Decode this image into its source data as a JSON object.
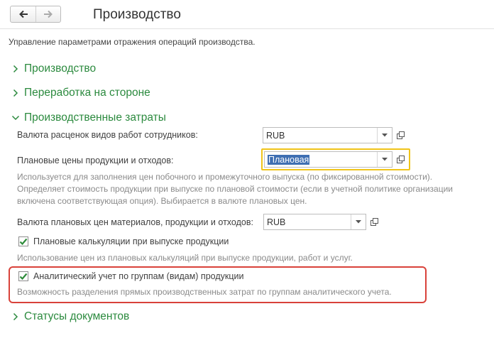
{
  "window": {
    "title": "Производство"
  },
  "nav": {
    "back_icon": "arrow-left-icon",
    "forward_icon": "arrow-right-icon"
  },
  "description": "Управление параметрами отражения операций производства.",
  "sections": [
    {
      "title": "Производство",
      "expanded": false
    },
    {
      "title": "Переработка на стороне",
      "expanded": false
    },
    {
      "title": "Производственные затраты",
      "expanded": true
    },
    {
      "title": "Статусы документов",
      "expanded": false
    }
  ],
  "fields": {
    "rate_currency": {
      "label": "Валюта расценок видов работ сотрудников:",
      "value": "RUB"
    },
    "planned_prices": {
      "label": "Плановые цены продукции и отходов:",
      "value": "Плановая",
      "hint": [
        "Используется для заполнения цен побочного и промежуточного выпуска (по фиксированной стоимости).",
        "Определяет стоимость продукции при выпуске по плановой стоимости (если в учетной политике организации",
        "включена соответствующая опция). Выбирается в валюте плановых цен."
      ]
    },
    "planned_currency": {
      "label": "Валюта плановых цен материалов, продукции и отходов:",
      "value": "RUB"
    },
    "planned_calc": {
      "label": "Плановые калькуляции при выпуске продукции",
      "checked": true,
      "hint": "Использование цен из плановых калькуляций при выпуске продукции, работ и услуг."
    },
    "analytic_accounting": {
      "label": "Аналитический учет по группам (видам) продукции",
      "checked": true,
      "hint": "Возможность разделения прямых производственных затрат по группам аналитического учета."
    }
  },
  "colors": {
    "section_green": "#2b8a3e",
    "focus_yellow": "#f0c419",
    "highlight_red": "#d9423a",
    "selection_blue": "#3f6fb2"
  }
}
